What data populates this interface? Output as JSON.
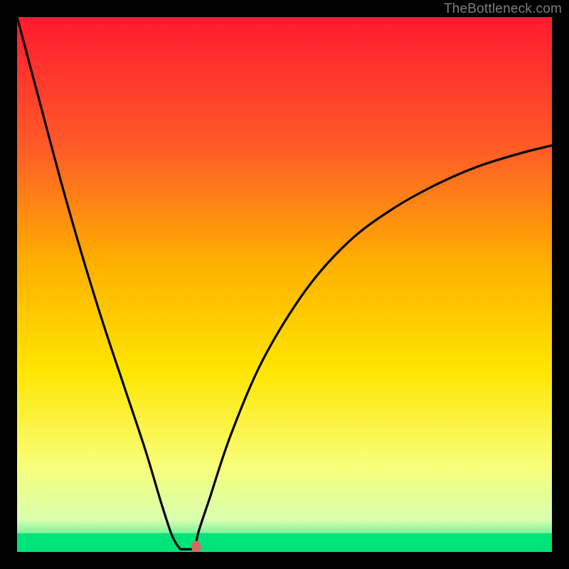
{
  "watermark": "TheBottleneck.com",
  "colors": {
    "background": "#000000",
    "curve": "#000000",
    "marker": "#d46a5f",
    "gradient_top": "#ff1a2f",
    "gradient_upper": "#ff5a28",
    "gradient_mid_upper": "#ffb000",
    "gradient_mid": "#ffe500",
    "gradient_lower": "#f8ff7a",
    "gradient_band": "#d8ffb0",
    "gradient_bottom": "#00e47a"
  },
  "chart_data": {
    "type": "line",
    "title": "",
    "xlabel": "",
    "ylabel": "",
    "xlim": [
      0,
      100
    ],
    "ylim": [
      0,
      100
    ],
    "grid": false,
    "series": [
      {
        "name": "bottleneck-curve",
        "x": [
          0,
          4,
          8,
          12,
          16,
          20,
          24,
          27,
          29,
          30.5,
          31.5,
          33,
          34,
          36,
          40,
          46,
          54,
          62,
          70,
          78,
          86,
          94,
          100
        ],
        "y": [
          100,
          85,
          70,
          56,
          43,
          31,
          19,
          9,
          3,
          0.5,
          0.5,
          1.5,
          4,
          10,
          22,
          36,
          49,
          58,
          64,
          68.5,
          72,
          74.5,
          76
        ]
      }
    ],
    "notch": {
      "x_start": 30.5,
      "x_end": 33.2,
      "y": 0.5
    },
    "marker": {
      "x": 33.5,
      "y": 0.9,
      "rx": 0.9,
      "ry": 1.2
    },
    "green_band": {
      "y_start": 96.5,
      "y_end": 100
    }
  }
}
